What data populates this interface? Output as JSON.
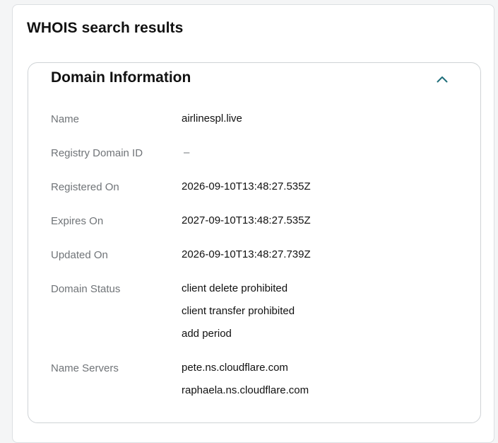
{
  "page": {
    "title": "WHOIS search results"
  },
  "section": {
    "title": "Domain Information",
    "toggle_icon": "chevron-up-icon",
    "accent_color": "#1f6e7a"
  },
  "rows": {
    "name": {
      "label": "Name",
      "values": [
        "airlinespl.live"
      ]
    },
    "registry_domain_id": {
      "label": "Registry Domain ID",
      "values": [
        "–"
      ]
    },
    "registered_on": {
      "label": "Registered On",
      "values": [
        "2026-09-10T13:48:27.535Z"
      ]
    },
    "expires_on": {
      "label": "Expires On",
      "values": [
        "2027-09-10T13:48:27.535Z"
      ]
    },
    "updated_on": {
      "label": "Updated On",
      "values": [
        "2026-09-10T13:48:27.739Z"
      ]
    },
    "domain_status": {
      "label": "Domain Status",
      "values": [
        "client delete prohibited",
        "client transfer prohibited",
        "add period"
      ]
    },
    "name_servers": {
      "label": "Name Servers",
      "values": [
        "pete.ns.cloudflare.com",
        "raphaela.ns.cloudflare.com"
      ]
    }
  }
}
